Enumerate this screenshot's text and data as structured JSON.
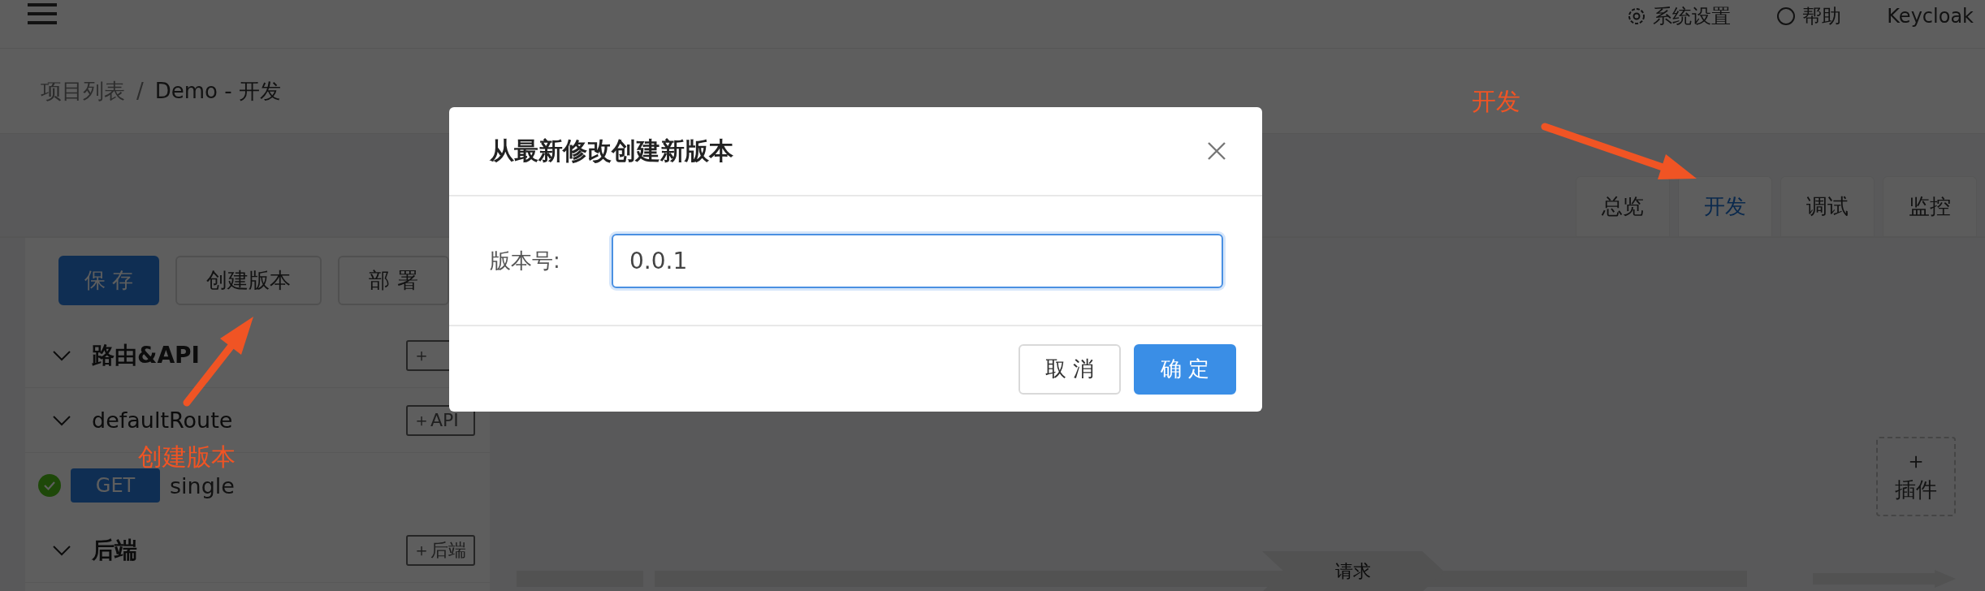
{
  "topbar": {
    "actions": [
      {
        "kind": "settings",
        "label": "系统设置"
      },
      {
        "kind": "help",
        "label": "帮助"
      },
      {
        "kind": "user",
        "label": "Keycloak"
      }
    ]
  },
  "breadcrumb": {
    "items": [
      "项目列表",
      "Demo - 开发"
    ],
    "separator": "/"
  },
  "tabs": [
    {
      "label": "总览",
      "selected": false
    },
    {
      "label": "开发",
      "selected": true
    },
    {
      "label": "调试",
      "selected": false
    },
    {
      "label": "监控",
      "selected": false
    }
  ],
  "toolbar": [
    {
      "label": "保 存",
      "kind": "primary"
    },
    {
      "label": "创建版本",
      "kind": "default"
    },
    {
      "label": "部 署",
      "kind": "default"
    }
  ],
  "tree": [
    {
      "label": "路由&API",
      "kind": "section",
      "expanded": true,
      "add": "＋",
      "children": [
        {
          "label": "defaultRoute",
          "kind": "route",
          "expanded": true,
          "add": "＋API",
          "children": [
            {
              "kind": "api",
              "method": "GET",
              "label": "single",
              "ok": true
            }
          ]
        }
      ]
    },
    {
      "label": "后端",
      "kind": "section",
      "expanded": true,
      "add": "＋后端"
    }
  ],
  "plugin_button": {
    "icon": "＋",
    "label": "插件"
  },
  "flow": {
    "stage": "请求"
  },
  "dialog": {
    "title": "从最新修改创建新版本",
    "field_label": "版本号:",
    "value": "0.0.1",
    "buttons": [
      {
        "label": "取 消",
        "kind": "default"
      },
      {
        "label": "确 定",
        "kind": "primary"
      }
    ]
  },
  "annotations": [
    {
      "label": "创建版本"
    },
    {
      "label": "开发"
    }
  ]
}
